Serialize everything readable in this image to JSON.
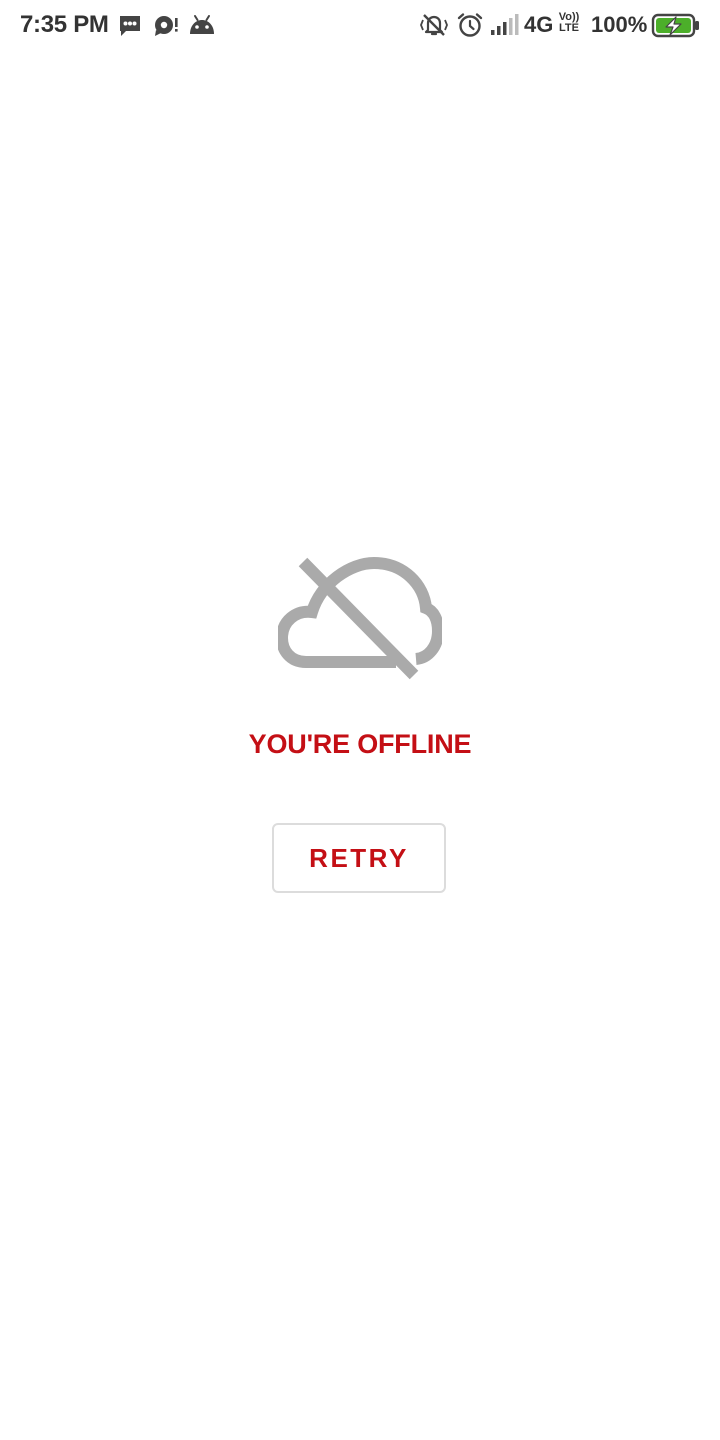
{
  "status_bar": {
    "time": "7:35 PM",
    "network": "4G",
    "volte_top": "Vo))",
    "volte_bottom": "LTE",
    "battery_percent": "100%",
    "battery_level": 1.0,
    "icons": [
      "message-icon",
      "notification-icon",
      "android-icon",
      "mute-icon",
      "alarm-icon",
      "signal-icon",
      "battery-charging-icon"
    ],
    "battery_color": "#4caf2a"
  },
  "offline": {
    "icon": "cloud-off-icon",
    "message": "YOU'RE OFFLINE",
    "retry_label": "RETRY"
  },
  "colors": {
    "accent": "#c40f15",
    "icon_gray": "#aaaaaa"
  }
}
